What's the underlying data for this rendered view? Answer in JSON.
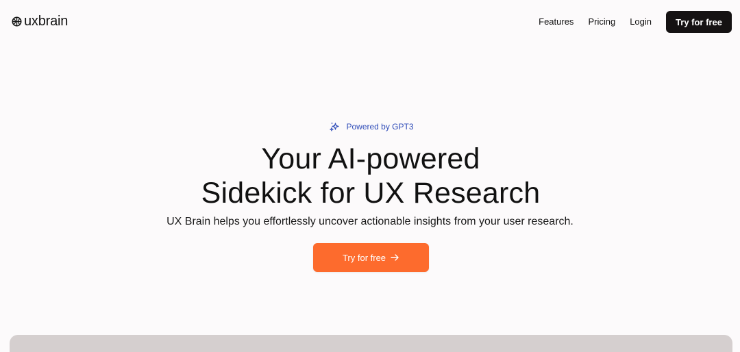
{
  "header": {
    "logo_text": "uxbrain",
    "logo_icon": "brain-globe-icon",
    "nav": {
      "features": "Features",
      "pricing": "Pricing",
      "login": "Login",
      "cta": "Try for free"
    }
  },
  "hero": {
    "badge_icon": "sparkles-icon",
    "badge_text": "Powered by GPT3",
    "title_line1": "Your AI-powered",
    "title_line2": "Sidekick for UX Research",
    "subtitle": "UX Brain helps you effortlessly uncover actionable insights from your user research.",
    "cta_label": "Try for free",
    "cta_icon": "arrow-right-icon"
  },
  "colors": {
    "background": "#fcfafb",
    "accent": "#fd6b2d",
    "dark_button": "#151213",
    "badge": "#2e4bb8",
    "preview_panel": "#d5cfcf"
  }
}
